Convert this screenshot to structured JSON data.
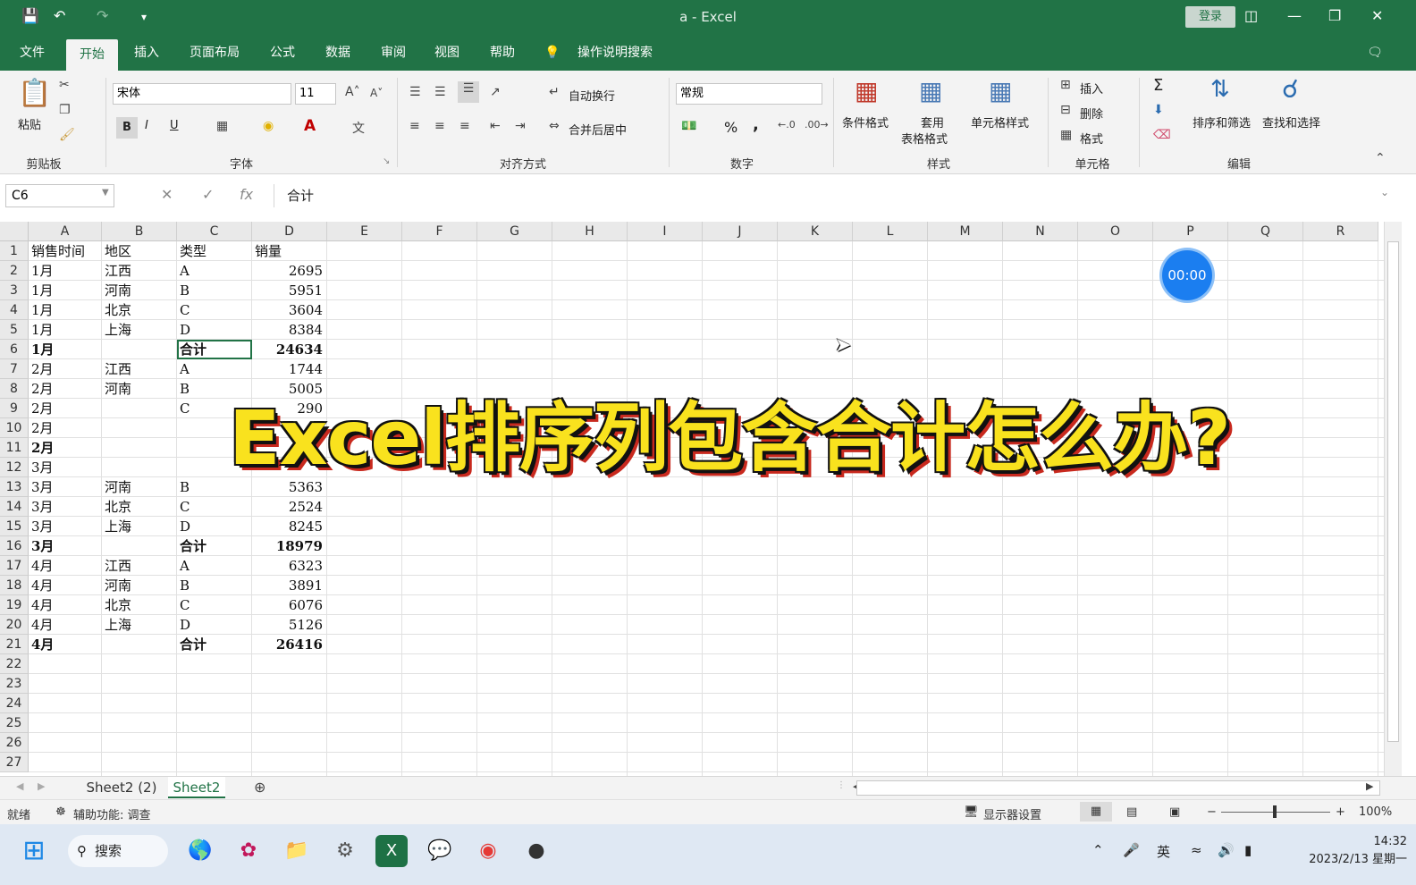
{
  "window": {
    "title": "a  -  Excel",
    "login_label": "登录",
    "quick_access": [
      "save-icon",
      "undo-icon",
      "redo-icon",
      "customize-icon"
    ]
  },
  "ribbon_tabs": [
    "文件",
    "开始",
    "插入",
    "页面布局",
    "公式",
    "数据",
    "审阅",
    "视图",
    "帮助"
  ],
  "active_tab": "开始",
  "tell_me": "操作说明搜索",
  "ribbon": {
    "clipboard": {
      "paste": "粘贴",
      "label": "剪贴板"
    },
    "font": {
      "name": "宋体",
      "size": "11",
      "bold": "B",
      "italic": "I",
      "underline": "U",
      "font_color": "A",
      "label": "字体"
    },
    "alignment": {
      "wrap": "自动换行",
      "merge": "合并后居中",
      "label": "对齐方式"
    },
    "number": {
      "format": "常规",
      "percent": "%",
      "comma": ",",
      "label": "数字"
    },
    "styles": {
      "conditional": "条件格式",
      "table1": "套用",
      "table2": "表格格式",
      "cell_styles": "单元格样式",
      "label": "样式"
    },
    "cells": {
      "insert": "插入",
      "delete": "删除",
      "format": "格式",
      "label": "单元格"
    },
    "editing": {
      "sigma": "Σ",
      "sort": "排序和筛选",
      "find": "查找和选择",
      "label": "编辑"
    }
  },
  "formula_bar": {
    "name_box": "C6",
    "fx": "fx",
    "cancel": "✕",
    "enter": "✓",
    "content": "合计"
  },
  "columns": [
    "A",
    "B",
    "C",
    "D",
    "E",
    "F",
    "G",
    "H",
    "I",
    "J",
    "K",
    "L",
    "M",
    "N",
    "O",
    "P",
    "Q",
    "R"
  ],
  "row_numbers": [
    "1",
    "2",
    "3",
    "4",
    "5",
    "6",
    "7",
    "8",
    "9",
    "10",
    "11",
    "12",
    "13",
    "14",
    "15",
    "16",
    "17",
    "18",
    "19",
    "20",
    "21",
    "22",
    "23",
    "24",
    "25",
    "26",
    "27"
  ],
  "rows": [
    {
      "a": "销售时间",
      "b": "地区",
      "c": "类型",
      "d": "销量",
      "bold": false,
      "d_num": false
    },
    {
      "a": "1月",
      "b": "江西",
      "c": "A",
      "d": "2695",
      "bold": false
    },
    {
      "a": "1月",
      "b": "河南",
      "c": "B",
      "d": "5951",
      "bold": false
    },
    {
      "a": "1月",
      "b": "北京",
      "c": "C",
      "d": "3604",
      "bold": false
    },
    {
      "a": "1月",
      "b": "上海",
      "c": "D",
      "d": "8384",
      "bold": false
    },
    {
      "a": "1月",
      "b": "",
      "c": "合计",
      "d": "24634",
      "bold": true
    },
    {
      "a": "2月",
      "b": "江西",
      "c": "A",
      "d": "1744",
      "bold": false
    },
    {
      "a": "2月",
      "b": "河南",
      "c": "B",
      "d": "5005",
      "bold": false
    },
    {
      "a": "2月",
      "b": "",
      "c": "C",
      "d": "290",
      "bold": false
    },
    {
      "a": "2月",
      "b": "",
      "c": "",
      "d": "",
      "bold": false
    },
    {
      "a": "2月",
      "b": "",
      "c": "",
      "d": "",
      "bold": true
    },
    {
      "a": "3月",
      "b": "",
      "c": "",
      "d": "",
      "bold": false
    },
    {
      "a": "3月",
      "b": "河南",
      "c": "B",
      "d": "5363",
      "bold": false
    },
    {
      "a": "3月",
      "b": "北京",
      "c": "C",
      "d": "2524",
      "bold": false
    },
    {
      "a": "3月",
      "b": "上海",
      "c": "D",
      "d": "8245",
      "bold": false
    },
    {
      "a": "3月",
      "b": "",
      "c": "合计",
      "d": "18979",
      "bold": true
    },
    {
      "a": "4月",
      "b": "江西",
      "c": "A",
      "d": "6323",
      "bold": false
    },
    {
      "a": "4月",
      "b": "河南",
      "c": "B",
      "d": "3891",
      "bold": false
    },
    {
      "a": "4月",
      "b": "北京",
      "c": "C",
      "d": "6076",
      "bold": false
    },
    {
      "a": "4月",
      "b": "上海",
      "c": "D",
      "d": "5126",
      "bold": false
    },
    {
      "a": "4月",
      "b": "",
      "c": "合计",
      "d": "26416",
      "bold": true
    }
  ],
  "sheets": [
    "Sheet2 (2)",
    "Sheet2"
  ],
  "active_sheet": "Sheet2",
  "status": {
    "ready": "就绪",
    "accessibility": "辅助功能: 调查",
    "display_settings": "显示器设置",
    "zoom": "100%"
  },
  "taskbar": {
    "search": "搜索",
    "ime": "英",
    "time": "14:32",
    "date": "2023/2/13 星期一"
  },
  "overlay": {
    "headline": "Excel排序列包含合计怎么办?",
    "timer": "00:00"
  },
  "colors": {
    "excel_green": "#217346",
    "headline_yellow": "#f9e21e",
    "headline_red": "#c8291e",
    "timer_blue": "#1b7ef0"
  }
}
